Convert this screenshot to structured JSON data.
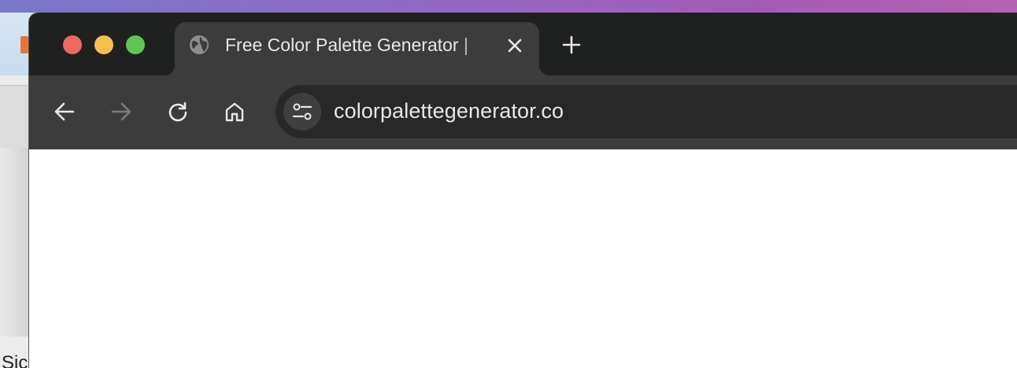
{
  "background_app": {
    "partial_text": "Sic"
  },
  "browser": {
    "window_controls": {
      "close": "close-window",
      "minimize": "minimize-window",
      "maximize": "maximize-window"
    },
    "tab": {
      "title": "Free Color Palette Generator | ",
      "favicon": "globe-icon",
      "close_icon": "close-icon"
    },
    "new_tab_icon": "plus-icon",
    "toolbar": {
      "back_icon": "arrow-left-icon",
      "forward_icon": "arrow-right-icon",
      "reload_icon": "reload-icon",
      "home_icon": "home-icon",
      "site_info_icon": "tune-icon"
    },
    "omnibox": {
      "url": "colorpalettegenerator.co"
    }
  },
  "colors": {
    "tab_strip": "#1f2020",
    "toolbar": "#3c3c3c",
    "omnibox": "#282828",
    "close": "#ed6a5e",
    "minimize": "#f4bf4f",
    "maximize": "#61c554"
  }
}
